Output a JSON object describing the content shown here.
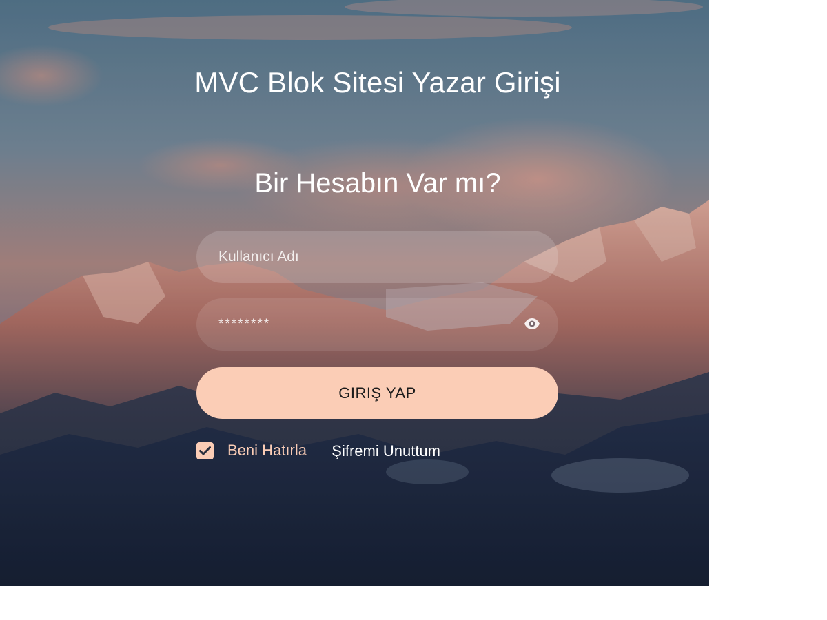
{
  "page": {
    "title": "MVC Blok Sitesi Yazar Girişi",
    "subtitle": "Bir Hesabın Var mı?"
  },
  "form": {
    "username_placeholder": "Kullanıcı Adı",
    "password_value": "********",
    "login_button_label": "GIRIŞ YAP",
    "remember_label": "Beni Hatırla",
    "remember_checked": true,
    "forgot_label": "Şifremi Unuttum"
  },
  "icons": {
    "password_toggle": "eye-icon",
    "remember_check": "check-icon"
  },
  "colors": {
    "accent": "#fbcdb6",
    "text_light": "#ffffff"
  }
}
